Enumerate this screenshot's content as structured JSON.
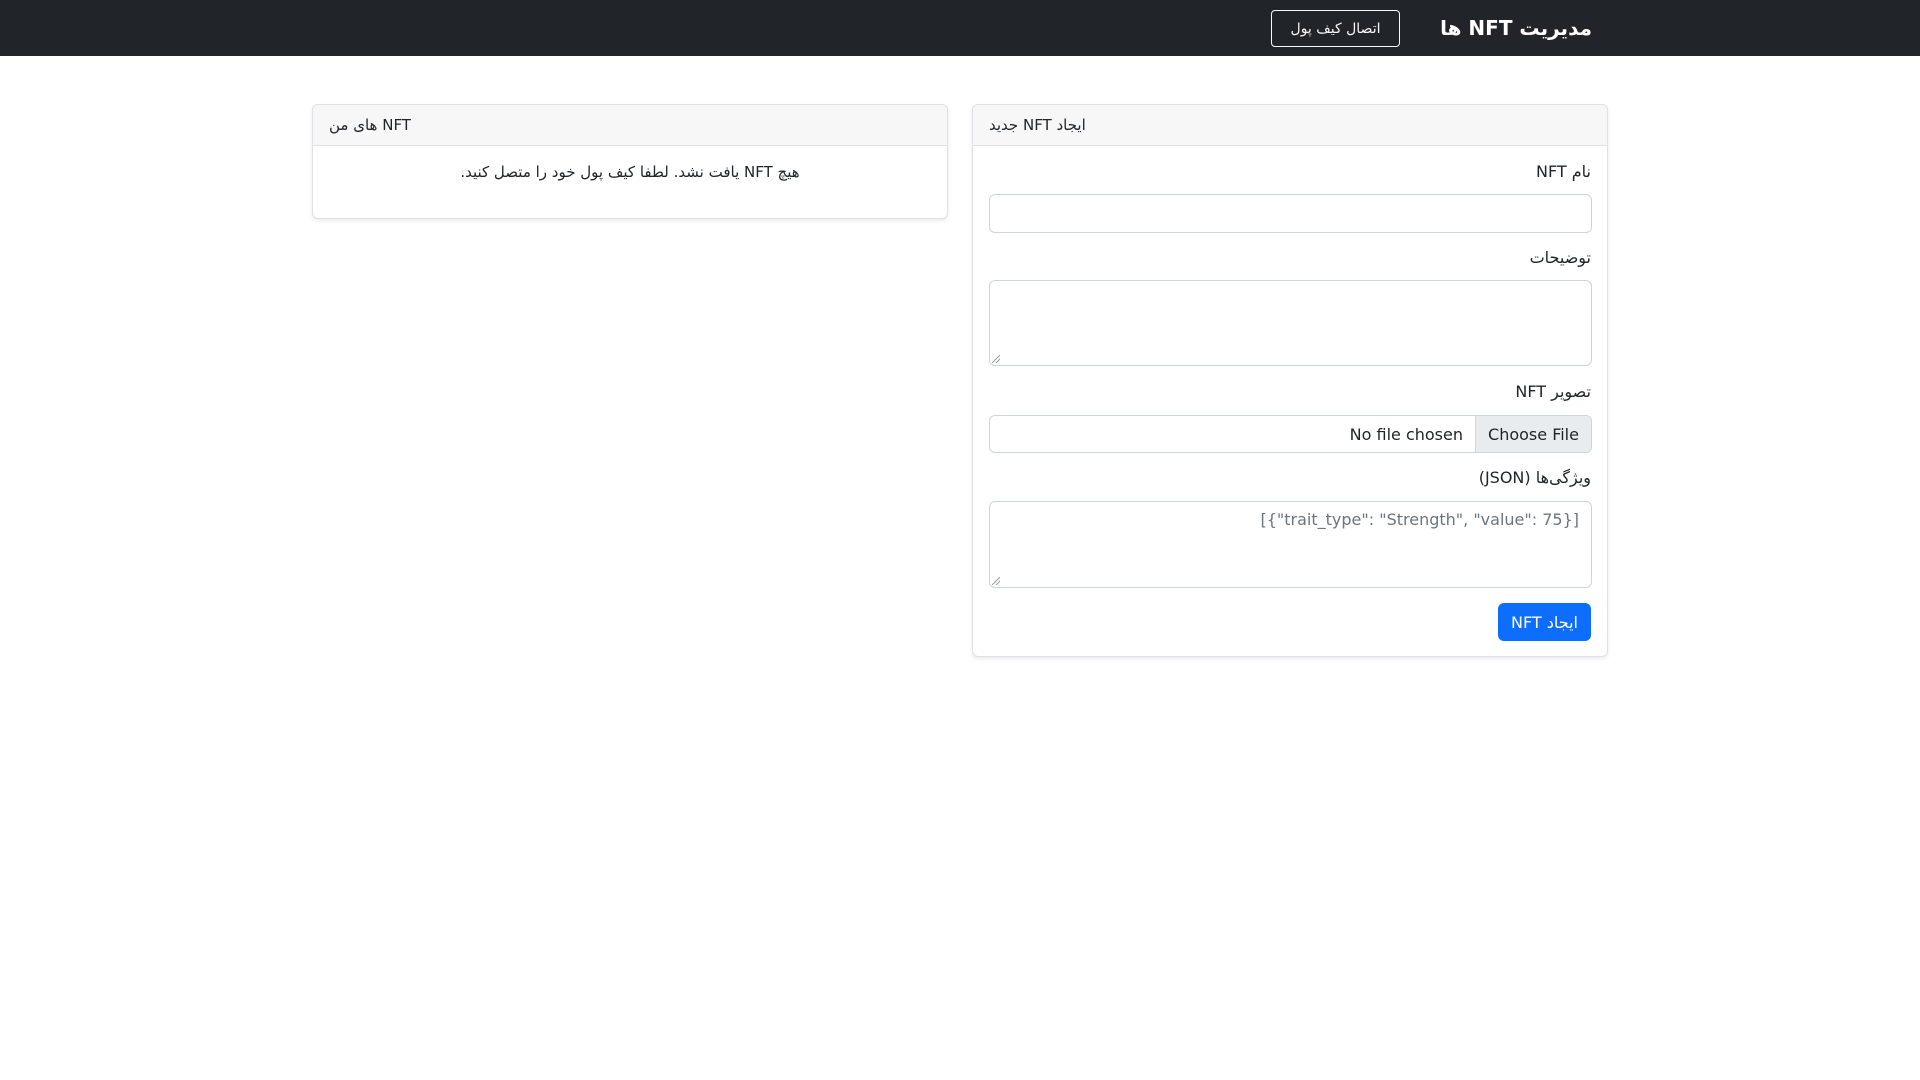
{
  "navbar": {
    "brand": "مدیریت NFT ها",
    "connect_wallet_label": "اتصال کیف پول"
  },
  "create_card": {
    "title": "ایجاد NFT جدید",
    "name_label": "نام NFT",
    "name_value": "",
    "description_label": "توضیحات",
    "description_value": "",
    "image_label": "تصویر NFT",
    "file_button_label": "Choose File",
    "file_status": "No file chosen",
    "attributes_label": "ویژگی‌ها (JSON)",
    "attributes_placeholder": "[{\"trait_type\": \"Strength\", \"value\": 75}]",
    "submit_label": "ایجاد NFT"
  },
  "my_nfts_card": {
    "title": "NFT های من",
    "empty_message": "هیچ NFT یافت نشد. لطفا کیف پول خود را متصل کنید."
  },
  "colors": {
    "navbar_bg": "#212529",
    "primary": "#0d6efd",
    "card_header_bg": "#f7f7f7"
  }
}
